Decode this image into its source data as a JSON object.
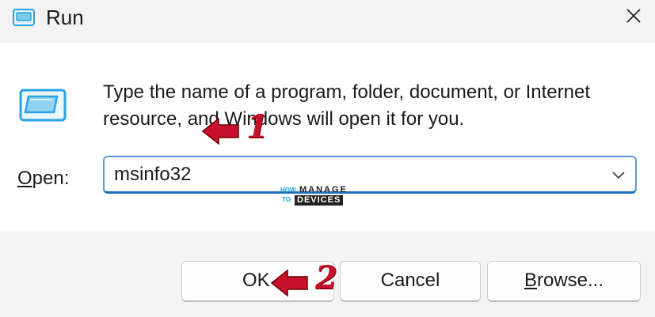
{
  "window": {
    "title": "Run",
    "close_icon": "close-icon",
    "app_icon": "run-dialog-icon"
  },
  "content": {
    "description": "Type the name of a program, folder, document, or Internet resource, and Windows will open it for you.",
    "open_label_mnemonic": "O",
    "open_label_rest": "pen:",
    "open_value": "msinfo32",
    "dropdown_icon": "chevron-down-icon"
  },
  "buttons": {
    "ok": "OK",
    "cancel": "Cancel",
    "browse_mnemonic": "B",
    "browse_rest": "rowse..."
  },
  "annotations": {
    "step1": "1",
    "step2": "2",
    "color": "#c8102e"
  },
  "watermark": {
    "how": "HOW",
    "to": "TO",
    "manage": "MANAGE",
    "devices": "DEVICES"
  },
  "colors": {
    "titlebar_bg": "#f3f3f3",
    "footer_bg": "#f3f3f3",
    "accent_border": "#1f6fbf",
    "icon_blue": "#29a3e0"
  }
}
